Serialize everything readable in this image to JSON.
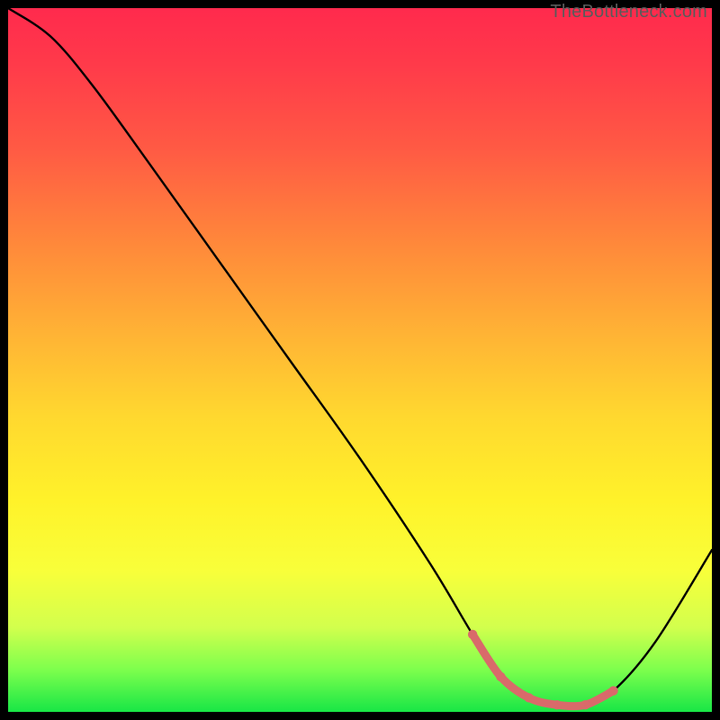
{
  "attribution": "TheBottleneck.com",
  "chart_data": {
    "type": "line",
    "title": "",
    "xlabel": "",
    "ylabel": "",
    "xlim": [
      0,
      100
    ],
    "ylim": [
      0,
      100
    ],
    "series": [
      {
        "name": "bottleneck-curve",
        "x": [
          0,
          6,
          12,
          20,
          30,
          40,
          50,
          60,
          66,
          70,
          74,
          78,
          82,
          86,
          92,
          100
        ],
        "values": [
          100,
          96,
          89,
          78,
          64,
          50,
          36,
          21,
          11,
          5,
          2,
          1,
          1,
          3,
          10,
          23
        ]
      }
    ],
    "highlight_range": {
      "x_start": 66,
      "x_end": 86
    },
    "highlight_color": "#d96a6a",
    "curve_color": "#000000",
    "gradient_stops": [
      {
        "pos": 0,
        "color": "#ff2a4d"
      },
      {
        "pos": 20,
        "color": "#ff5a44"
      },
      {
        "pos": 46,
        "color": "#ffb235"
      },
      {
        "pos": 70,
        "color": "#fff22a"
      },
      {
        "pos": 100,
        "color": "#18e646"
      }
    ]
  }
}
